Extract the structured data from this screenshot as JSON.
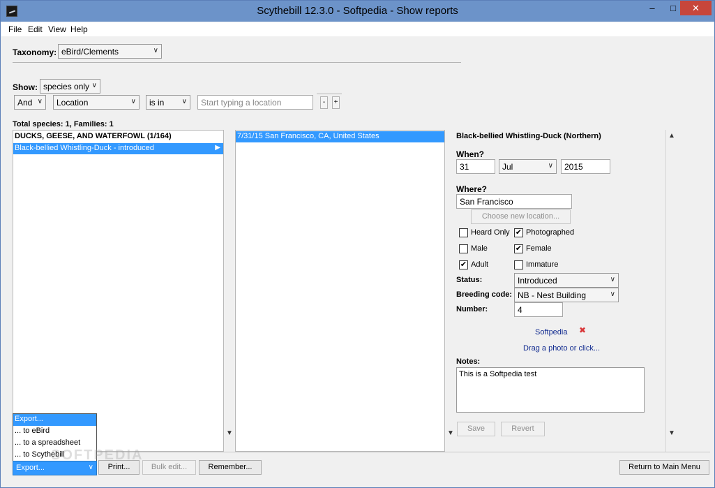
{
  "window": {
    "title": "Scythebill 12.3.0 - Softpedia - Show reports",
    "minimize": "–",
    "maximize": "□",
    "close": "✕"
  },
  "menu": [
    "File",
    "Edit",
    "View",
    "Help"
  ],
  "taxonomy": {
    "label": "Taxonomy:",
    "value": "eBird/Clements"
  },
  "show": {
    "label": "Show:",
    "value": "species only"
  },
  "filter": {
    "conjunction": "And",
    "field": "Location",
    "operator": "is in",
    "placeholder": "Start typing a location",
    "remove_label": "-",
    "add_label": "+"
  },
  "totals": "Total species: 1, Families: 1",
  "species_list": [
    {
      "text": "DUCKS, GEESE, AND WATERFOWL (1/164)",
      "kind": "family"
    },
    {
      "text": "Black-bellied Whistling-Duck - introduced",
      "kind": "species",
      "selected": true
    }
  ],
  "sightings": [
    {
      "text": "7/31/15 San Francisco, CA, United States",
      "selected": true
    }
  ],
  "detail": {
    "title": "Black-bellied Whistling-Duck (Northern)",
    "when_label": "When?",
    "day": "31",
    "month": "Jul",
    "year": "2015",
    "where_label": "Where?",
    "where_value": "San Francisco",
    "choose_location": "Choose new location...",
    "checks": {
      "heard_only": {
        "label": "Heard Only",
        "checked": false
      },
      "photographed": {
        "label": "Photographed",
        "checked": true
      },
      "male": {
        "label": "Male",
        "checked": false
      },
      "female": {
        "label": "Female",
        "checked": true
      },
      "adult": {
        "label": "Adult",
        "checked": true
      },
      "immature": {
        "label": "Immature",
        "checked": false
      }
    },
    "check_mark": "✔",
    "status_label": "Status:",
    "status_value": "Introduced",
    "breeding_label": "Breeding code:",
    "breeding_value": "NB - Nest Building",
    "number_label": "Number:",
    "number_value": "4",
    "photo_name": "Softpedia",
    "photo_remove": "✖",
    "photo_hint": "Drag a photo or click...",
    "notes_label": "Notes:",
    "notes_value": "This is a Softpedia test",
    "save": "Save",
    "revert": "Revert"
  },
  "export_popup": [
    "Export...",
    "... to eBird",
    "... to a spreadsheet",
    "... to Scythebill"
  ],
  "footer": {
    "export": "Export...",
    "print": "Print...",
    "bulk_edit": "Bulk edit...",
    "remember": "Remember...",
    "return_main": "Return to Main Menu"
  },
  "scroll": {
    "up": "▲",
    "down": "▼",
    "right": "▶"
  },
  "chevron": "⌵",
  "watermark": "SOFTPEDIA"
}
